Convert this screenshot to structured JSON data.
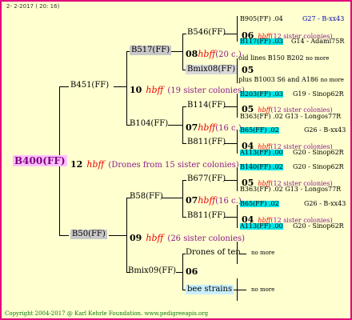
{
  "header_date": "2- 2-2017 ( 20: 16)",
  "footer": "Copyright 2004-2017 @ Karl Kehrle Foundation.   www.pedigreeapis.org",
  "root": {
    "name": "B400(FF)",
    "num": "12",
    "hbff": "hbff",
    "sisters": "(Drones from 15 sister colonies)"
  },
  "gen1": [
    {
      "name": "B451(FF)",
      "num": "10",
      "hbff": "hbff",
      "sisters": "(19 sister colonies)"
    },
    {
      "name": "B50(FF)",
      "num": "09",
      "hbff": "hbff",
      "sisters": "(26 sister colonies)"
    }
  ],
  "gen2": [
    {
      "name": "B517(FF)",
      "num": "08",
      "hbff": "hbff",
      "sisters": "(20 c.)"
    },
    {
      "name": "B104(FF)",
      "num": "07",
      "hbff": "hbff",
      "sisters": "(16 c.)"
    },
    {
      "name": "B58(FF)",
      "num": "07",
      "hbff": "hbff",
      "sisters": "(16 c.)"
    },
    {
      "name": "Bmix09(FF)",
      "num": "06"
    }
  ],
  "gen3": [
    {
      "name": "B546(FF)",
      "num": "06",
      "hbff": "hbff",
      "sisters": "(12 sister colonies)"
    },
    {
      "name": "Bmix08(FF)",
      "num": "05"
    },
    {
      "name": "B114(FF)",
      "num": "05",
      "hbff": "hbff",
      "sisters": "(12 sister colonies)"
    },
    {
      "name": "B811(FF)",
      "num": "04",
      "hbff": "hbff",
      "sisters": "(12 sister colonies)"
    },
    {
      "name": "B677(FF)",
      "num": "05",
      "hbff": "hbff",
      "sisters": "(12 sister colonies)"
    },
    {
      "name": "B811(FF)",
      "num": "04",
      "hbff": "hbff",
      "sisters": "(12 sister colonies)"
    },
    {
      "name": "Drones of ten"
    },
    {
      "name": "bee strains"
    }
  ],
  "leaves": [
    {
      "a": "B905(FF) .04",
      "b": "G27 - B-xx43"
    },
    {
      "a": "B117(FF) .03",
      "b": "G14 - Adami75R"
    },
    {
      "a": "old lines B150 B202",
      "b": "no more"
    },
    {
      "a": "plus B1003 S6 and A186",
      "b": "no more"
    },
    {
      "a": "B203(FF) .03",
      "b": "G19 - Sinop62R"
    },
    {
      "a": "B363(FF) .02",
      "b": "G13 - Longos77R"
    },
    {
      "a": "B65(FF) .02",
      "b": "G26 - B-xx43"
    },
    {
      "a": "A113(FF) .00",
      "b": "G20 - Sinop62R"
    },
    {
      "a": "B140(FF) .02",
      "b": "G20 - Sinop62R"
    },
    {
      "a": "B363(FF) .02",
      "b": "G13 - Longos77R"
    },
    {
      "a": "B65(FF) .02",
      "b": "G26 - B-xx43"
    },
    {
      "a": "A113(FF) .00",
      "b": "G20 - Sinop62R"
    },
    {
      "a": "no more"
    },
    {
      "a": "no more"
    }
  ]
}
